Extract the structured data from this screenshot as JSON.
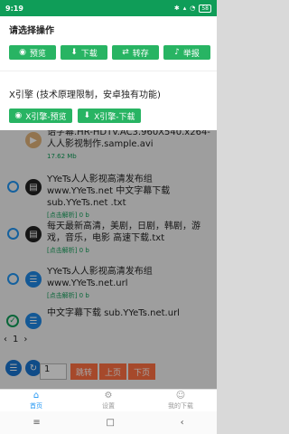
{
  "status": {
    "time": "9:19",
    "battery": "58"
  },
  "modal": {
    "title": "请选择操作",
    "buttons": [
      {
        "label": "预览",
        "icon": "eye"
      },
      {
        "label": "下载",
        "icon": "download"
      },
      {
        "label": "转存",
        "icon": "swap"
      },
      {
        "label": "举报",
        "icon": "bell"
      }
    ],
    "x_title": "X引擎",
    "x_note": "(技术原理限制，安卓独有功能)",
    "x_buttons": [
      {
        "label": "X引擎-预览",
        "icon": "eye"
      },
      {
        "label": "X引擎-下载",
        "icon": "download"
      }
    ]
  },
  "list": [
    {
      "text": "语字幕.HR-HDTV.AC3.960X540.x264-人人影视制作.sample.avi",
      "meta": "17.62 Mb"
    },
    {
      "text": "YYeTs人人影视高清发布组 www.YYeTs.net 中文字幕下载 sub.YYeTs.net .txt",
      "meta": "[点击解析] 0 b"
    },
    {
      "text": "每天最新高清，美剧，日剧，韩剧，游戏，音乐，电影 高速下载.txt",
      "meta": "[点击解析] 0 b"
    },
    {
      "text": "YYeTs人人影视高清发布组 www.YYeTs.net.url",
      "meta": "[点击解析] 0 b"
    },
    {
      "text": "中文字幕下载 sub.YYeTs.net.url",
      "meta": ""
    }
  ],
  "pager": {
    "prev_arrow": "‹",
    "page": "1",
    "next_arrow": "›",
    "input_value": "1",
    "jump": "跳转",
    "prev": "上页",
    "next": "下页"
  },
  "tabs": [
    {
      "label": "首页",
      "icon": "home"
    },
    {
      "label": "设置",
      "icon": "gear"
    },
    {
      "label": "我的下载",
      "icon": "user"
    }
  ],
  "colors": {
    "green": "#28b463",
    "status": "#0f9d58",
    "accent": "#2196f3",
    "orange": "#ff7043"
  }
}
